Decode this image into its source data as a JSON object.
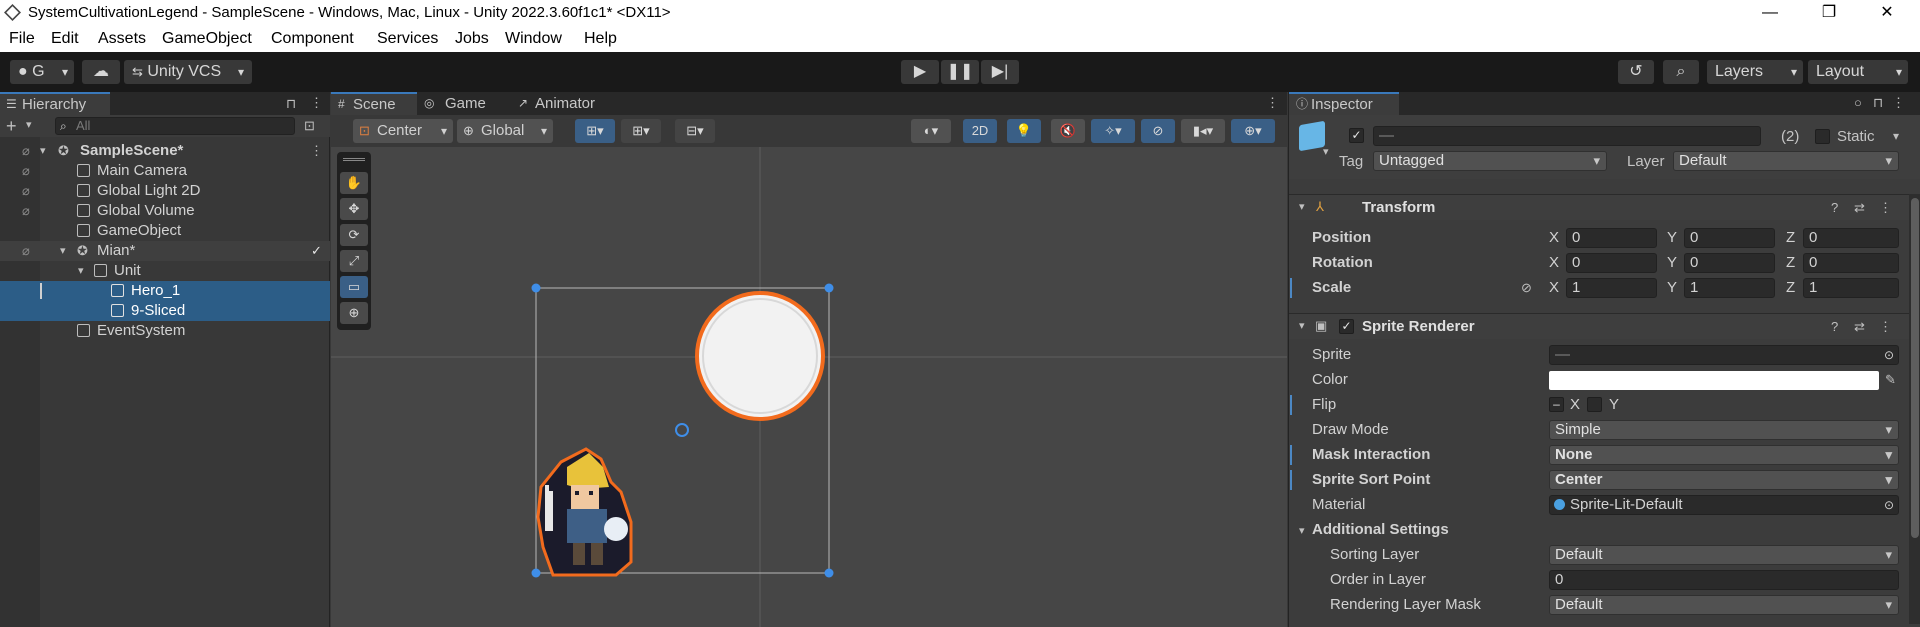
{
  "window": {
    "title": "SystemCultivationLegend - SampleScene - Windows, Mac, Linux - Unity 2022.3.60f1c1* <DX11>"
  },
  "menu": [
    "File",
    "Edit",
    "Assets",
    "GameObject",
    "Component",
    "Services",
    "Jobs",
    "Window",
    "Help"
  ],
  "toolbar": {
    "account_label": "G",
    "vcs_label": "Unity VCS",
    "layers_label": "Layers",
    "layout_label": "Layout"
  },
  "hierarchy": {
    "tab": "Hierarchy",
    "search_placeholder": "All",
    "rows": [
      {
        "label": "SampleScene*",
        "indent": 0
      },
      {
        "label": "Main Camera",
        "indent": 1
      },
      {
        "label": "Global Light 2D",
        "indent": 1
      },
      {
        "label": "Global Volume",
        "indent": 1
      },
      {
        "label": "GameObject",
        "indent": 1
      },
      {
        "label": "Mian*",
        "indent": 1
      },
      {
        "label": "Unit",
        "indent": 2
      },
      {
        "label": "Hero_1",
        "indent": 3
      },
      {
        "label": "9-Sliced",
        "indent": 3
      },
      {
        "label": "EventSystem",
        "indent": 1
      }
    ]
  },
  "scene": {
    "tabs": [
      "Scene",
      "Game",
      "Animator"
    ],
    "pivot_label": "Center",
    "space_label": "Global",
    "mode_2d_label": "2D"
  },
  "inspector": {
    "tab": "Inspector",
    "name_value": "—",
    "count_label": "(2)",
    "static_label": "Static",
    "tag_label": "Tag",
    "tag_value": "Untagged",
    "layer_label": "Layer",
    "layer_value": "Default",
    "transform": {
      "title": "Transform",
      "position": {
        "label": "Position",
        "x": "0",
        "y": "0",
        "z": "0"
      },
      "rotation": {
        "label": "Rotation",
        "x": "0",
        "y": "0",
        "z": "0"
      },
      "scale": {
        "label": "Scale",
        "x": "1",
        "y": "1",
        "z": "1"
      }
    },
    "sprite_renderer": {
      "title": "Sprite Renderer",
      "sprite_label": "Sprite",
      "sprite_value": "—",
      "color_label": "Color",
      "flip_label": "Flip",
      "flip_x": "X",
      "flip_y": "Y",
      "draw_mode_label": "Draw Mode",
      "draw_mode_value": "Simple",
      "mask_interaction_label": "Mask Interaction",
      "mask_interaction_value": "None",
      "sort_point_label": "Sprite Sort Point",
      "sort_point_value": "Center",
      "material_label": "Material",
      "material_value": "Sprite-Lit-Default",
      "additional_settings_label": "Additional Settings",
      "sorting_layer_label": "Sorting Layer",
      "sorting_layer_value": "Default",
      "order_in_layer_label": "Order in Layer",
      "order_in_layer_value": "0",
      "rendering_layer_mask_label": "Rendering Layer Mask",
      "rendering_layer_mask_value": "Default"
    }
  },
  "axis_letters": {
    "x": "X",
    "y": "Y",
    "z": "Z"
  },
  "colors": {
    "selection": "#2c5d87",
    "accent": "#3a79bb",
    "outline_orange": "#f26b1d"
  }
}
